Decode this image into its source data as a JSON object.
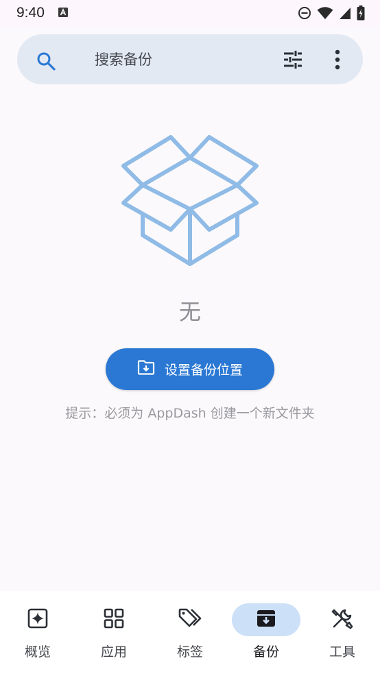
{
  "status_bar": {
    "time": "9:40"
  },
  "search": {
    "placeholder": "搜索备份"
  },
  "empty_state": {
    "title": "无",
    "button_label": "设置备份位置",
    "hint": "提示：必须为 AppDash 创建一个新文件夹"
  },
  "bottom_nav": {
    "items": [
      {
        "label": "概览",
        "icon": "sparkle-icon",
        "active": false
      },
      {
        "label": "应用",
        "icon": "grid-icon",
        "active": false
      },
      {
        "label": "标签",
        "icon": "tags-icon",
        "active": false
      },
      {
        "label": "备份",
        "icon": "archive-icon",
        "active": true
      },
      {
        "label": "工具",
        "icon": "tools-icon",
        "active": false
      }
    ]
  },
  "colors": {
    "accent": "#2a78d3",
    "search_bg": "#e3e9f3",
    "nav_active_pill": "#cce0f7",
    "box_illustration": "#8fbbe6"
  }
}
